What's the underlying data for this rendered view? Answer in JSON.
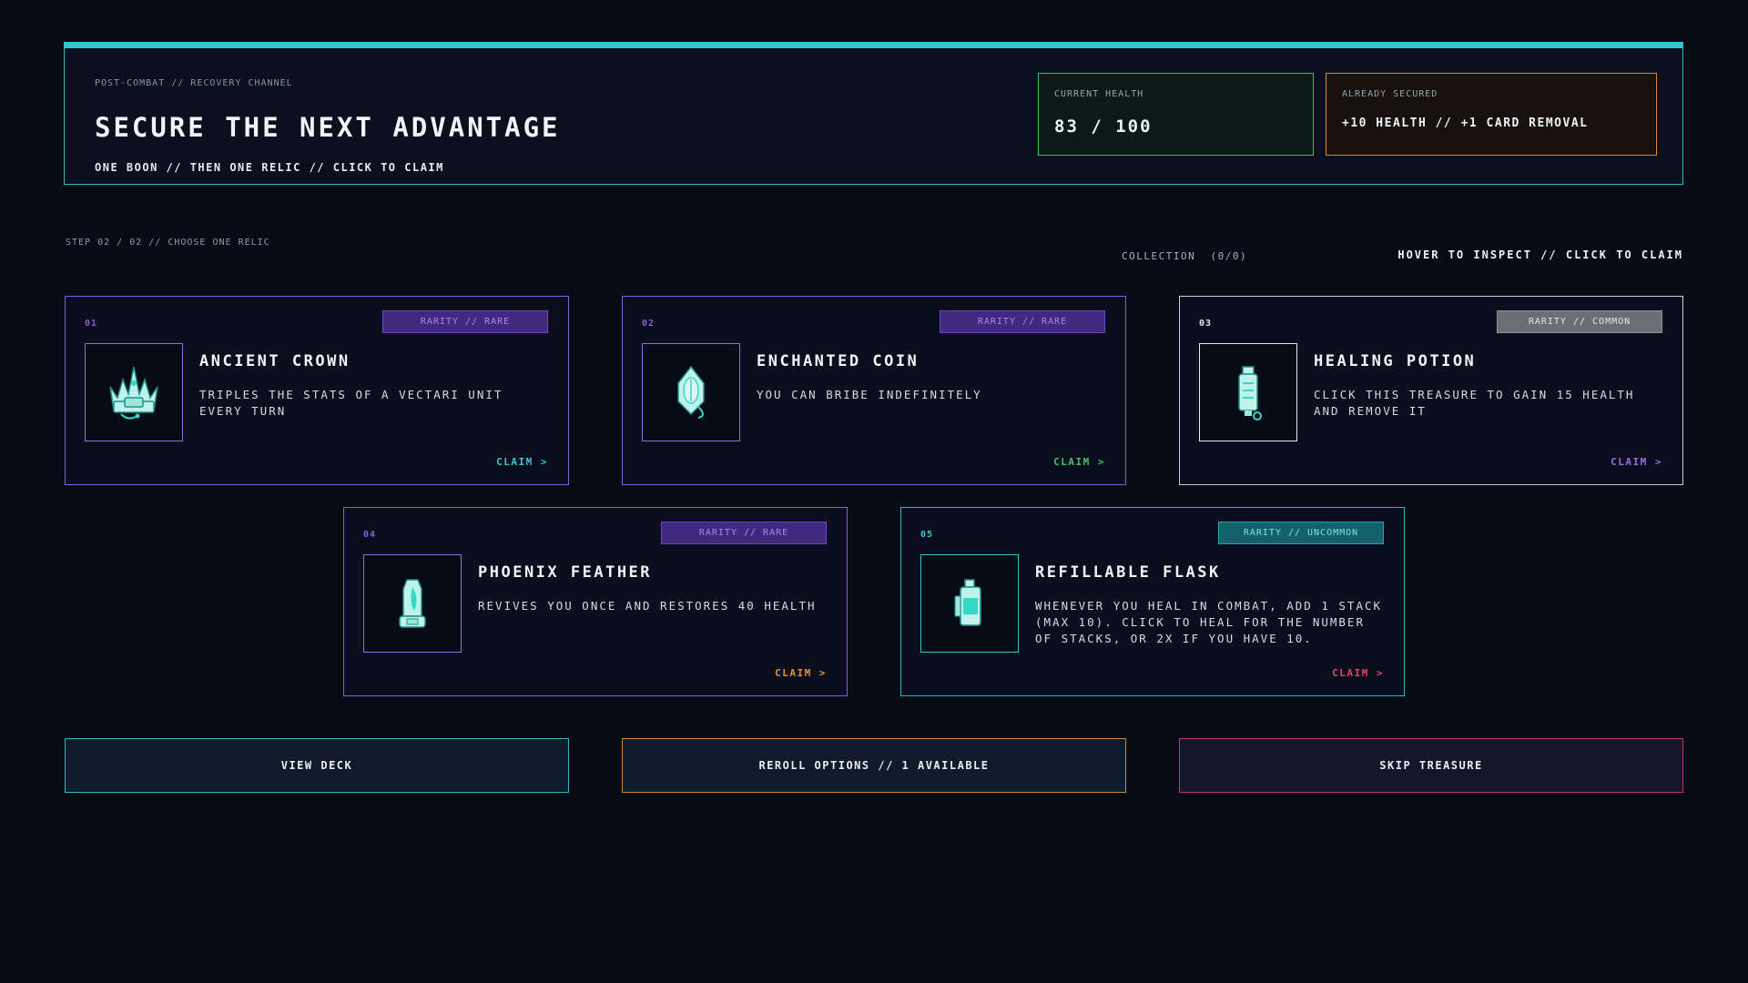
{
  "header": {
    "kicker": "POST-COMBAT // RECOVERY CHANNEL",
    "title": "SECURE THE NEXT ADVANTAGE",
    "subtitle": "ONE BOON // THEN ONE RELIC // CLICK TO CLAIM",
    "health_label": "CURRENT HEALTH",
    "health_value": "83 / 100",
    "secured_label": "ALREADY SECURED",
    "secured_value": "+10 HEALTH // +1 CARD REMOVAL"
  },
  "step": "STEP 02 / 02 // CHOOSE ONE RELIC",
  "collection": "COLLECTION  (0/0)",
  "hint": "HOVER TO INSPECT // CLICK TO CLAIM",
  "relics": [
    {
      "num": "01",
      "rarity": "RARITY // RARE",
      "name": "ANCIENT CROWN",
      "icon": "crown-icon",
      "desc": "TRIPLES THE STATS OF A VECTARI UNIT EVERY TURN",
      "claim": "CLAIM  >",
      "claim_color": "#36c6d6",
      "num_color": "#8a5cd6"
    },
    {
      "num": "02",
      "rarity": "RARITY // RARE",
      "name": "ENCHANTED COIN",
      "icon": "coin-icon",
      "desc": "YOU CAN BRIBE INDEFINITELY",
      "claim": "CLAIM  >",
      "claim_color": "#3fc46a",
      "num_color": "#8a5cd6"
    },
    {
      "num": "03",
      "rarity": "RARITY // COMMON",
      "name": "HEALING POTION",
      "icon": "potion-icon",
      "desc": "CLICK THIS TREASURE TO GAIN 15 HEALTH AND REMOVE IT",
      "claim": "CLAIM  >",
      "claim_color": "#9c6be6",
      "num_color": "#e6e8ee"
    },
    {
      "num": "04",
      "rarity": "RARITY // RARE",
      "name": "PHOENIX FEATHER",
      "icon": "feather-icon",
      "desc": "REVIVES YOU ONCE AND RESTORES 40 HEALTH",
      "claim": "CLAIM  >",
      "claim_color": "#e0922e",
      "num_color": "#8a5cd6"
    },
    {
      "num": "05",
      "rarity": "RARITY // UNCOMMON",
      "name": "REFILLABLE FLASK",
      "icon": "flask-icon",
      "desc": "WHENEVER YOU HEAL IN COMBAT, ADD 1 STACK (MAX 10). CLICK TO HEAL FOR THE NUMBER OF STACKS, OR 2X IF YOU HAVE 10.",
      "claim": "CLAIM  >",
      "claim_color": "#e0436e",
      "num_color": "#36c6d6"
    }
  ],
  "buttons": {
    "view_deck": "VIEW DECK",
    "reroll": "REROLL OPTIONS // 1 AVAILABLE",
    "skip": "SKIP TREASURE"
  }
}
